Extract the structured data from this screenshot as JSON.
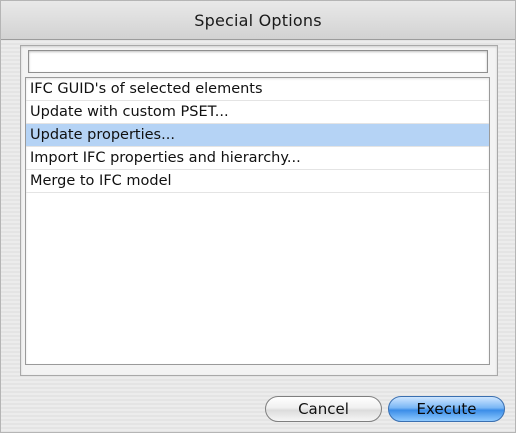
{
  "window": {
    "title": "Special Options"
  },
  "name_field": {
    "value": ""
  },
  "options": [
    {
      "label": "IFC GUID's of selected elements",
      "selected": false
    },
    {
      "label": "Update with custom PSET...",
      "selected": false
    },
    {
      "label": "Update properties...",
      "selected": true
    },
    {
      "label": "Import IFC properties and hierarchy...",
      "selected": false
    },
    {
      "label": "Merge to IFC model",
      "selected": false
    }
  ],
  "buttons": {
    "cancel_label": "Cancel",
    "execute_label": "Execute"
  },
  "colors": {
    "selection": "#b5d3f5",
    "default_button": "#3b8de8"
  }
}
